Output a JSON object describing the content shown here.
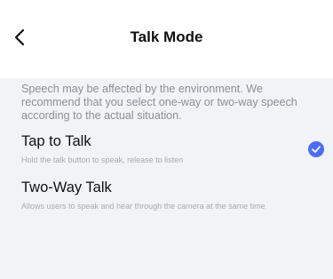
{
  "header": {
    "title": "Talk Mode",
    "back_icon": "chevron-left-icon"
  },
  "description": "Speech may be affected by the environment. We recommend that you select one-way or two-way speech according to the actual situation.",
  "options": [
    {
      "title": "Tap to Talk",
      "subtitle": "Hold the talk button to speak, release to listen",
      "selected": true
    },
    {
      "title": "Two-Way Talk",
      "subtitle": "Allows users to speak and hear through the camera at the same time",
      "selected": false
    }
  ],
  "colors": {
    "accent": "#4a6cf7",
    "background": "#f2f3f7",
    "header_bg": "#ffffff",
    "secondary_text": "#8c8f96"
  },
  "icons": {
    "selected": "check-circle-icon"
  }
}
